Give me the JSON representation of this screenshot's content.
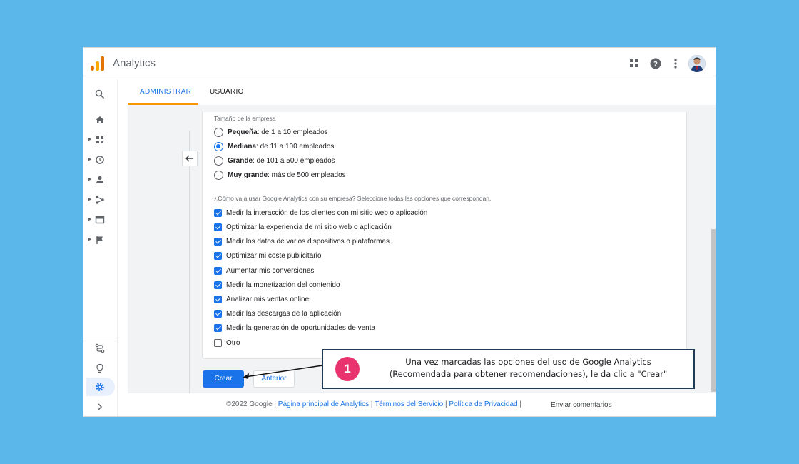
{
  "app": {
    "title": "Analytics"
  },
  "tabs": [
    {
      "label": "ADMINISTRAR",
      "active": true
    },
    {
      "label": "USUARIO",
      "active": false
    }
  ],
  "company_size": {
    "label": "Tamaño de la empresa",
    "options": [
      {
        "bold": "Pequeña",
        "rest": ": de 1 a 10 empleados",
        "selected": false
      },
      {
        "bold": "Mediana",
        "rest": ": de 11 a 100 empleados",
        "selected": true
      },
      {
        "bold": "Grande",
        "rest": ": de 101 a 500 empleados",
        "selected": false
      },
      {
        "bold": "Muy grande",
        "rest": ": más de 500 empleados",
        "selected": false
      }
    ]
  },
  "usage": {
    "label": "¿Cómo va a usar Google Analytics con su empresa? Seleccione todas las opciones que correspondan.",
    "options": [
      {
        "label": "Medir la interacción de los clientes con mi sitio web o aplicación",
        "checked": true
      },
      {
        "label": "Optimizar la experiencia de mi sitio web o aplicación",
        "checked": true
      },
      {
        "label": "Medir los datos de varios dispositivos o plataformas",
        "checked": true
      },
      {
        "label": "Optimizar mi coste publicitario",
        "checked": true
      },
      {
        "label": "Aumentar mis conversiones",
        "checked": true
      },
      {
        "label": "Medir la monetización del contenido",
        "checked": true
      },
      {
        "label": "Analizar mis ventas online",
        "checked": true
      },
      {
        "label": "Medir las descargas de la aplicación",
        "checked": true
      },
      {
        "label": "Medir la generación de oportunidades de venta",
        "checked": true
      },
      {
        "label": "Otro",
        "checked": false
      }
    ]
  },
  "buttons": {
    "create": "Crear",
    "previous": "Anterior"
  },
  "footer": {
    "copyright": "©2022 Google",
    "sep": " | ",
    "links": [
      "Página principal de Analytics",
      "Términos del Servicio",
      "Política de Privacidad"
    ],
    "feedback": "Enviar comentarios"
  },
  "callout": {
    "number": "1",
    "line1": "Una vez marcadas las opciones del uso de Google Analytics",
    "line2": "(Recomendada para obtener recomendaciones), le da clic a \"Crear\""
  },
  "colors": {
    "accent": "#1a73e8",
    "tab_underline": "#f29900",
    "badge": "#e8336e",
    "background": "#5bb7ea"
  }
}
